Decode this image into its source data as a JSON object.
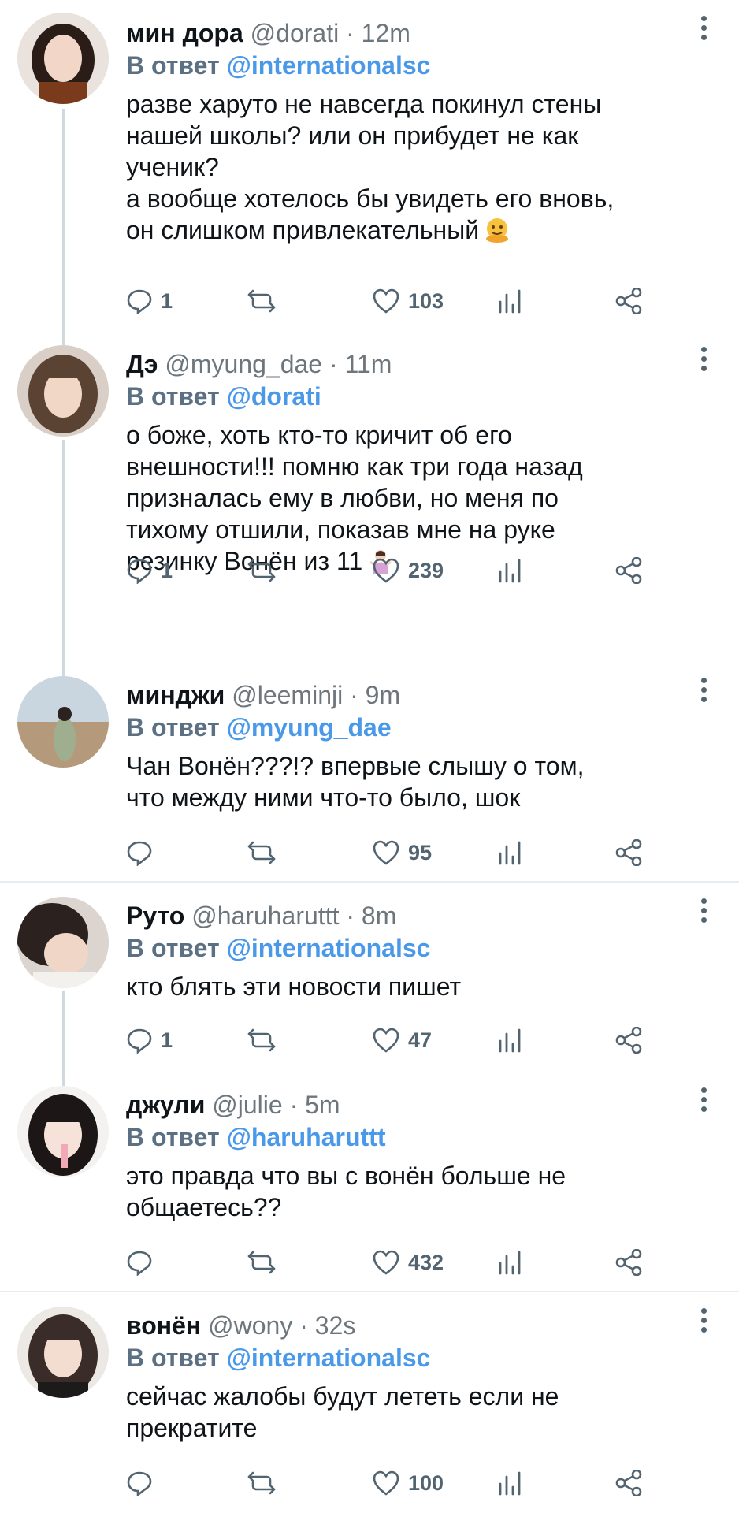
{
  "tweets": [
    {
      "name": "мин дора",
      "handle": "@dorati",
      "separator": "·",
      "time": "12m",
      "reply_label": "В ответ",
      "reply_to": "@internationalsc",
      "lines": [
        "разве харуто не навсегда покинул стены",
        "нашей школы? или он прибудет не как",
        "ученик?",
        "а вообще хотелось бы увидеть его вновь,",
        "он слишком привлекательный"
      ],
      "emoji": "melting-face-emoji",
      "replies": "1",
      "retweets": "",
      "likes": "103"
    },
    {
      "name": "Дэ",
      "handle": "@myung_dae",
      "separator": "·",
      "time": "11m",
      "reply_label": "В ответ",
      "reply_to": "@dorati",
      "lines": [
        "о боже, хоть кто-то кричит об его",
        "внешности!!! помню как три года назад",
        "призналась ему в любви, но меня по",
        "тихому отшили, показав мне на руке",
        "резинку Вонён из 11"
      ],
      "emoji": "person-shrugging-emoji",
      "replies": "1",
      "retweets": "",
      "likes": "239"
    },
    {
      "name": "минджи",
      "handle": "@leeminji",
      "separator": "·",
      "time": "9m",
      "reply_label": "В ответ",
      "reply_to": "@myung_dae",
      "lines": [
        "Чан Вонён???!? впервые слышу о том,",
        "что между ними что-то было, шок"
      ],
      "replies": "",
      "retweets": "",
      "likes": "95"
    },
    {
      "name": "Руто",
      "handle": "@haruharuttt",
      "separator": "·",
      "time": "8m",
      "reply_label": "В ответ",
      "reply_to": "@internationalsc",
      "lines": [
        "кто блять эти новости пишет"
      ],
      "replies": "1",
      "retweets": "",
      "likes": "47"
    },
    {
      "name": "джули",
      "handle": "@julie",
      "separator": "·",
      "time": "5m",
      "reply_label": "В ответ",
      "reply_to": "@haruharuttt",
      "lines": [
        "это правда что вы с вонён больше не",
        "общаетесь??"
      ],
      "replies": "",
      "retweets": "",
      "likes": "432"
    },
    {
      "name": "вонён",
      "handle": "@wony",
      "separator": "·",
      "time": "32s",
      "reply_label": "В ответ",
      "reply_to": "@internationalsc",
      "lines": [
        "сейчас жалобы будут лететь если не",
        "прекратите"
      ],
      "replies": "",
      "retweets": "",
      "likes": "100"
    }
  ],
  "icons": {
    "reply": "reply-icon",
    "retweet": "retweet-icon",
    "like": "like-icon",
    "analytics": "analytics-icon",
    "share": "share-icon",
    "more": "more-options-icon"
  },
  "colors": {
    "mention": "#4a99e9",
    "muted": "#6e767d",
    "text": "#0f1419",
    "thread_line": "#cfd9de"
  }
}
